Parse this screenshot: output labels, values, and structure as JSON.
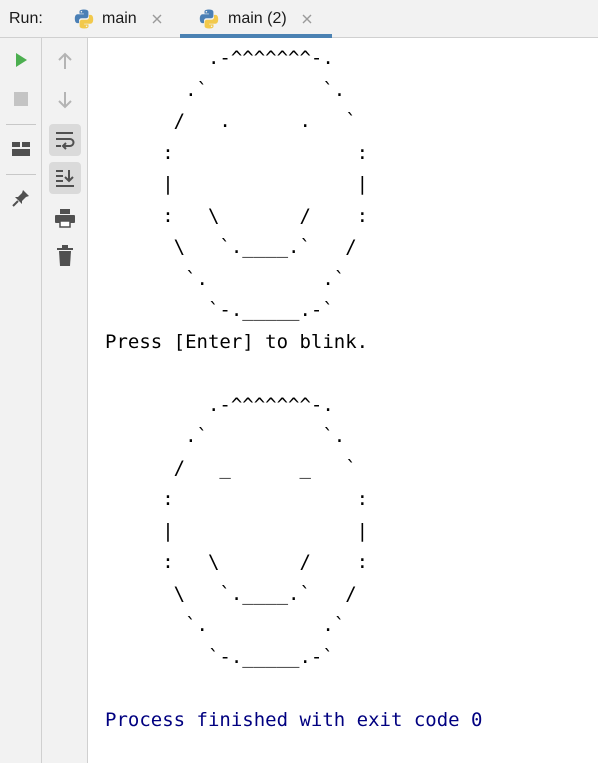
{
  "run_label": "Run:",
  "tabs": [
    {
      "label": "main",
      "icon": "python-icon",
      "active": false
    },
    {
      "label": "main (2)",
      "icon": "python-icon",
      "active": true
    }
  ],
  "toolbar_left": [
    "run-icon",
    "stop-icon",
    "layout-icon",
    "pin-icon"
  ],
  "toolbar_right": [
    "up-arrow-icon",
    "down-arrow-icon",
    "soft-wrap-icon",
    "scroll-to-end-icon",
    "print-icon",
    "trash-icon"
  ],
  "colors": {
    "run_green": "#4caf50",
    "tab_underline": "#4b82b3",
    "exit_text": "#000080",
    "panel_bg": "#f2f2f2"
  },
  "console": {
    "face1": [
      "         .-^^^^^^^-.",
      "       .`          `.",
      "      /   .      .   `",
      "     :                :",
      "     |                |",
      "     :   \\       /    :",
      "      \\   `.____.`   /",
      "       `.          .`",
      "         `-._____.-`"
    ],
    "prompt": "Press [Enter] to blink.",
    "face2": [
      "         .-^^^^^^^-.",
      "       .`          `.",
      "      /   _      _   `",
      "     :                :",
      "     |                |",
      "     :   \\       /    :",
      "      \\   `.____.`   /",
      "       `.          .`",
      "         `-._____.-`"
    ],
    "exit_message": "Process finished with exit code 0"
  }
}
